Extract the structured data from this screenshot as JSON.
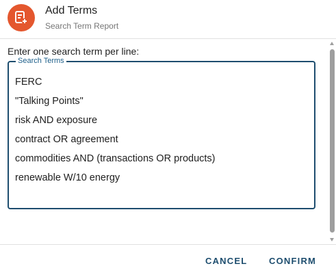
{
  "dialog": {
    "title": "Add Terms",
    "subtitle": "Search Term Report",
    "icon": "add-list-icon",
    "accent_color": "#e4572e"
  },
  "form": {
    "instructions": "Enter one search term per line:",
    "field_label": "Search Terms",
    "terms": [
      "FERC",
      "\"Talking Points\"",
      "risk AND exposure",
      "contract OR agreement",
      "commodities AND (transactions OR products)",
      "renewable W/10 energy"
    ],
    "border_color": "#1d4d6e"
  },
  "actions": {
    "cancel_label": "CANCEL",
    "confirm_label": "CONFIRM",
    "button_color": "#1d4d6e"
  }
}
